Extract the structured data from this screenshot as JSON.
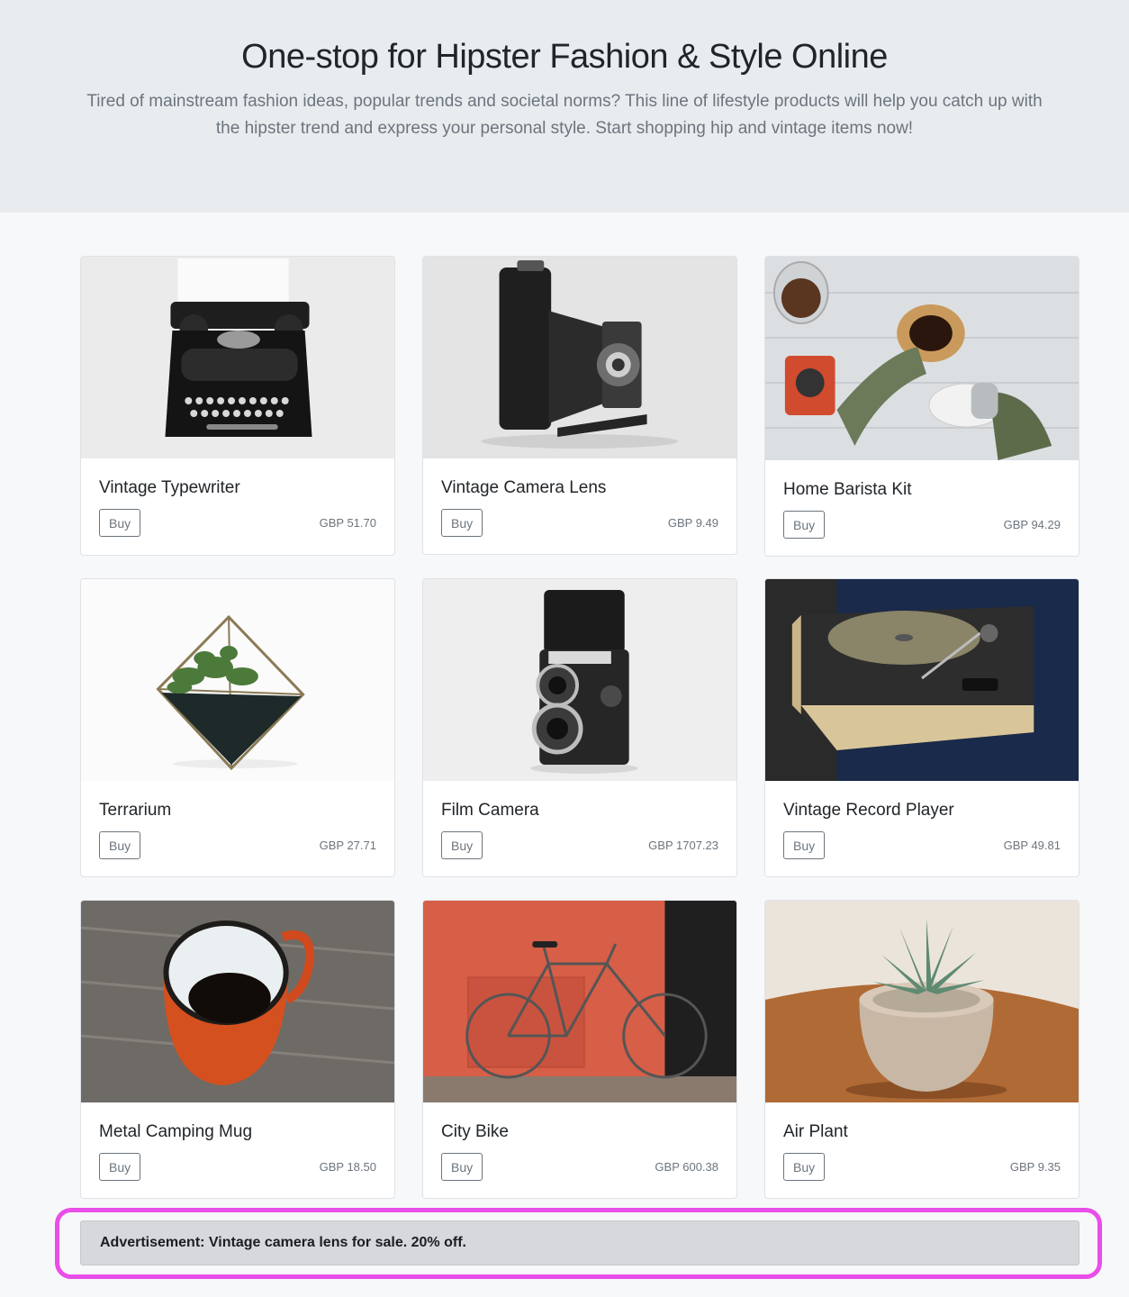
{
  "hero": {
    "title": "One-stop for Hipster Fashion & Style Online",
    "subtitle": "Tired of mainstream fashion ideas, popular trends and societal norms? This line of lifestyle products will help you catch up with the hipster trend and express your personal style. Start shopping hip and vintage items now!"
  },
  "products": [
    {
      "name": "Vintage Typewriter",
      "buy_label": "Buy",
      "price": "GBP 51.70",
      "image": "typewriter-photo"
    },
    {
      "name": "Vintage Camera Lens",
      "buy_label": "Buy",
      "price": "GBP 9.49",
      "image": "folding-camera-photo"
    },
    {
      "name": "Home Barista Kit",
      "buy_label": "Buy",
      "price": "GBP 94.29",
      "image": "barista-kit-photo"
    },
    {
      "name": "Terrarium",
      "buy_label": "Buy",
      "price": "GBP 27.71",
      "image": "terrarium-photo"
    },
    {
      "name": "Film Camera",
      "buy_label": "Buy",
      "price": "GBP 1707.23",
      "image": "film-camera-photo"
    },
    {
      "name": "Vintage Record Player",
      "buy_label": "Buy",
      "price": "GBP 49.81",
      "image": "record-player-photo"
    },
    {
      "name": "Metal Camping Mug",
      "buy_label": "Buy",
      "price": "GBP 18.50",
      "image": "camping-mug-photo"
    },
    {
      "name": "City Bike",
      "buy_label": "Buy",
      "price": "GBP 600.38",
      "image": "city-bike-photo"
    },
    {
      "name": "Air Plant",
      "buy_label": "Buy",
      "price": "GBP 9.35",
      "image": "air-plant-photo"
    }
  ],
  "advertisement": {
    "text": "Advertisement: Vintage camera lens for sale. 20% off.",
    "highlight_color": "#e94ee8"
  }
}
